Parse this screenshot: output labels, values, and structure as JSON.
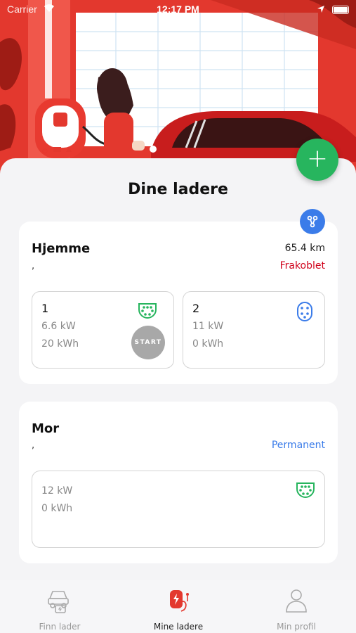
{
  "status_bar": {
    "carrier": "Carrier",
    "time": "12:17 PM"
  },
  "page": {
    "title": "Dine ladere"
  },
  "locations": [
    {
      "name": "Hjemme",
      "address": ",",
      "distance": "65.4 km",
      "status": "Frakoblet",
      "status_color": "#d0021b",
      "outlets": [
        {
          "number": "1",
          "power": "6.6 kW",
          "energy": "20 kWh",
          "plug_icon": "type2-plug-icon",
          "plug_color": "#27b55e",
          "action": "START"
        },
        {
          "number": "2",
          "power": "11 kW",
          "energy": "0 kWh",
          "plug_icon": "type1-plug-icon",
          "plug_color": "#3b7ce9"
        }
      ]
    },
    {
      "name": "Mor",
      "address": ",",
      "status": "Permanent",
      "status_color": "#3b7ce9",
      "outlets": [
        {
          "power": "12 kW",
          "energy": "0 kWh",
          "plug_icon": "type2-plug-icon",
          "plug_color": "#27b55e"
        }
      ]
    }
  ],
  "tabs": [
    {
      "label": "Finn lader",
      "icon": "car-charger-icon",
      "active": false
    },
    {
      "label": "Mine ladere",
      "icon": "charging-station-icon",
      "active": true
    },
    {
      "label": "Min profil",
      "icon": "user-profile-icon",
      "active": false
    }
  ],
  "colors": {
    "brand_red": "#e3382e",
    "green": "#27b55e",
    "blue": "#3b7ce9"
  }
}
